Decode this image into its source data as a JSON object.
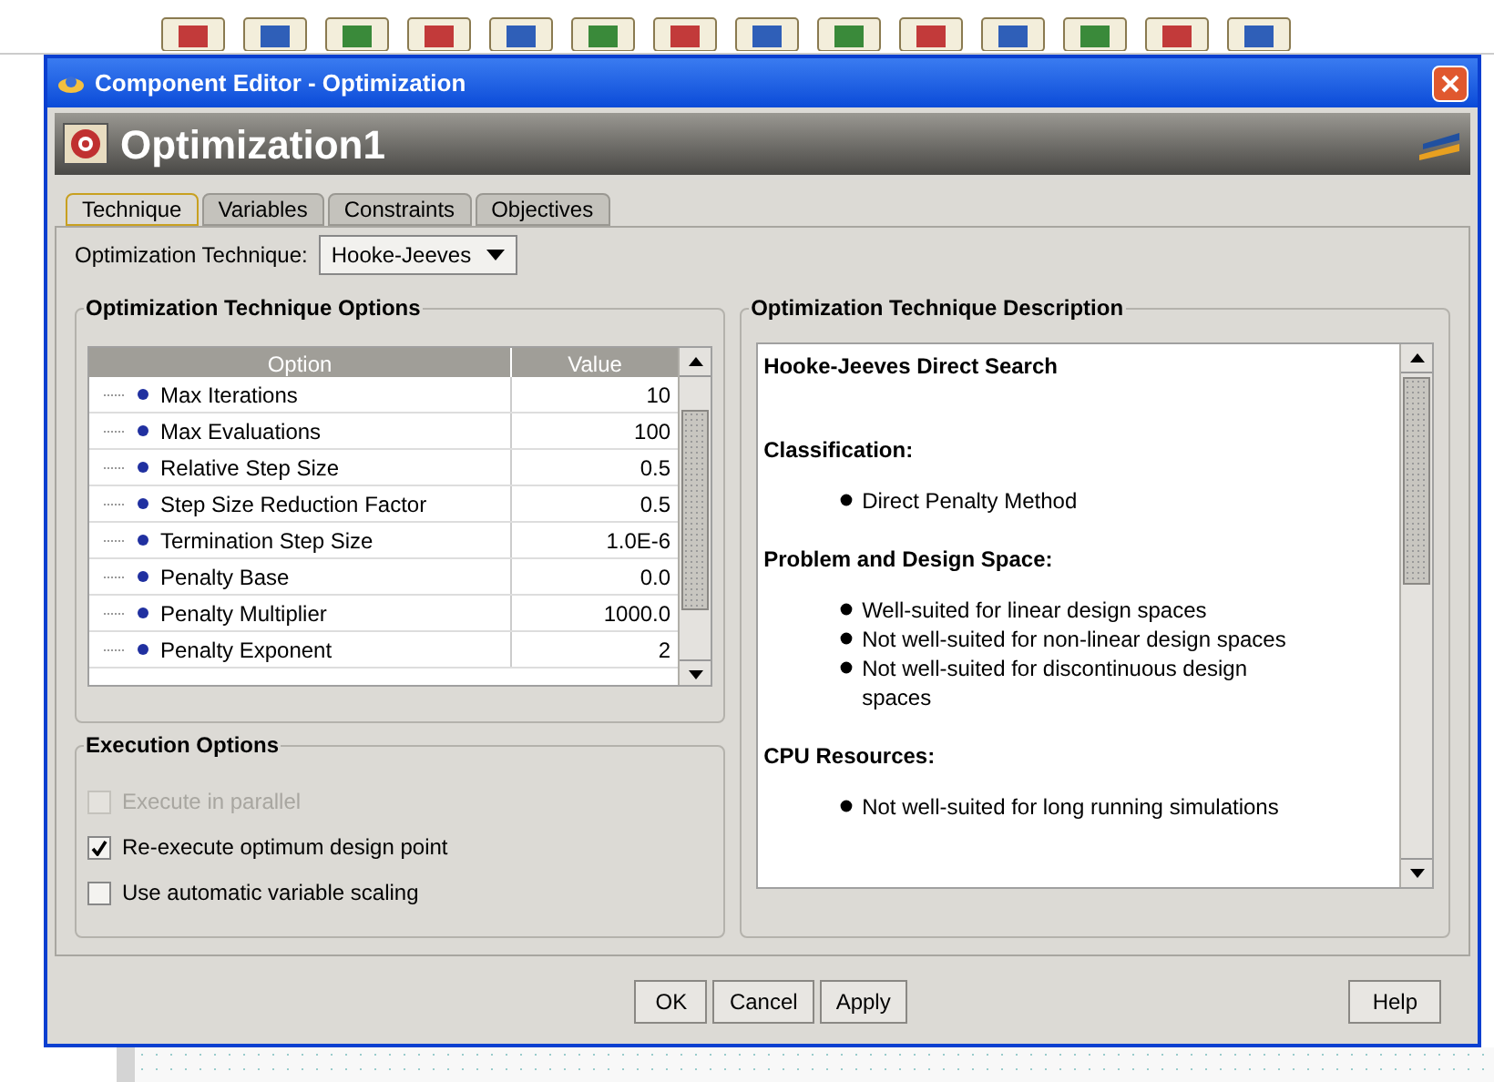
{
  "window": {
    "title": "Component Editor - Optimization",
    "component_name": "Optimization1"
  },
  "tabs": [
    {
      "label": "Technique",
      "selected": true
    },
    {
      "label": "Variables",
      "selected": false
    },
    {
      "label": "Constraints",
      "selected": false
    },
    {
      "label": "Objectives",
      "selected": false
    }
  ],
  "technique": {
    "label": "Optimization Technique:",
    "value": "Hooke-Jeeves"
  },
  "options": {
    "title": "Optimization Technique Options",
    "columns": [
      "Option",
      "Value"
    ],
    "rows": [
      {
        "option": "Max Iterations",
        "value": "10"
      },
      {
        "option": "Max Evaluations",
        "value": "100"
      },
      {
        "option": "Relative Step Size",
        "value": "0.5"
      },
      {
        "option": "Step Size Reduction Factor",
        "value": "0.5"
      },
      {
        "option": "Termination Step Size",
        "value": "1.0E-6"
      },
      {
        "option": "Penalty Base",
        "value": "0.0"
      },
      {
        "option": "Penalty Multiplier",
        "value": "1000.0"
      },
      {
        "option": "Penalty Exponent",
        "value": "2"
      }
    ]
  },
  "execution": {
    "title": "Execution Options",
    "items": [
      {
        "label": "Execute in parallel",
        "checked": false,
        "disabled": true
      },
      {
        "label": "Re-execute optimum design point",
        "checked": true,
        "disabled": false
      },
      {
        "label": "Use automatic variable scaling",
        "checked": false,
        "disabled": false
      }
    ]
  },
  "description": {
    "title": "Optimization Technique Description",
    "items": [
      {
        "kind": "title",
        "text": "Hooke-Jeeves Direct Search"
      },
      {
        "kind": "heading",
        "text": "Classification:"
      },
      {
        "kind": "bullet",
        "text": "Direct Penalty Method"
      },
      {
        "kind": "heading",
        "text": "Problem and Design Space:"
      },
      {
        "kind": "bullet",
        "text": "Well-suited for linear design spaces"
      },
      {
        "kind": "bullet",
        "text": "Not well-suited for non-linear design spaces"
      },
      {
        "kind": "bullet",
        "text": "Not well-suited for discontinuous design spaces"
      },
      {
        "kind": "heading",
        "text": "CPU Resources:"
      },
      {
        "kind": "bullet",
        "text": "Not well-suited for long running simulations"
      }
    ]
  },
  "buttons": [
    "OK",
    "Cancel",
    "Apply"
  ],
  "help_button": "Help"
}
